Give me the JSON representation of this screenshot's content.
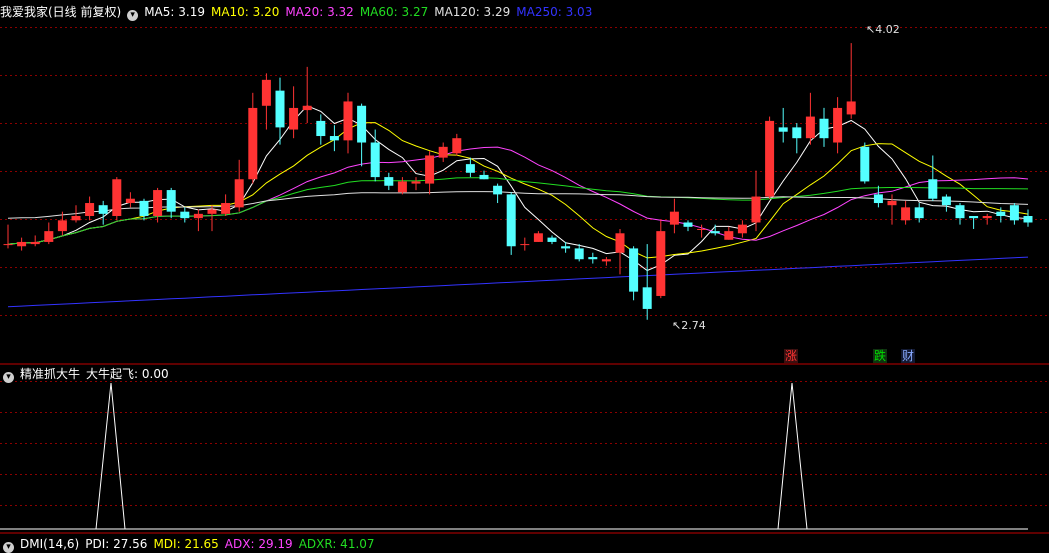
{
  "main_panel": {
    "title": "我爱我家(日线 前复权)",
    "indicators": [
      {
        "label": "MA5: 3.19",
        "color": "#ffffff"
      },
      {
        "label": "MA10: 3.20",
        "color": "#ffff00"
      },
      {
        "label": "MA20: 3.32",
        "color": "#ff44ff"
      },
      {
        "label": "MA60: 3.27",
        "color": "#22dd22"
      },
      {
        "label": "MA120: 3.29",
        "color": "#e0e0e0"
      },
      {
        "label": "MA250: 3.03",
        "color": "#3333ff"
      }
    ],
    "high_label": "4.02",
    "low_label": "2.74",
    "badges": [
      {
        "text": "涨",
        "color": "#ff3333"
      },
      {
        "text": "跌",
        "color": "#00dd00"
      },
      {
        "text": "财",
        "color": "#88aaff"
      }
    ]
  },
  "sub_panel": {
    "title": "精准抓大牛",
    "value_label": "大牛起飞: 0.00"
  },
  "dmi_panel": {
    "title": "DMI(14,6)",
    "values": [
      {
        "label": "PDI: 27.56",
        "color": "#ffffff"
      },
      {
        "label": "MDI: 21.65",
        "color": "#ffff00"
      },
      {
        "label": "ADX: 29.19",
        "color": "#ff44ff"
      },
      {
        "label": "ADXR: 41.07",
        "color": "#22dd22"
      }
    ]
  },
  "chart_data": {
    "type": "candlestick",
    "ylim": [
      2.6,
      4.15
    ],
    "candles": [
      [
        3.09,
        3.09,
        3.18,
        3.07
      ],
      [
        3.08,
        3.1,
        3.12,
        3.06
      ],
      [
        3.09,
        3.1,
        3.13,
        3.08
      ],
      [
        3.1,
        3.15,
        3.19,
        3.09
      ],
      [
        3.15,
        3.2,
        3.24,
        3.13
      ],
      [
        3.2,
        3.22,
        3.27,
        3.19
      ],
      [
        3.22,
        3.28,
        3.31,
        3.2
      ],
      [
        3.27,
        3.23,
        3.29,
        3.18
      ],
      [
        3.22,
        3.39,
        3.4,
        3.2
      ],
      [
        3.28,
        3.3,
        3.33,
        3.26
      ],
      [
        3.29,
        3.22,
        3.3,
        3.2
      ],
      [
        3.22,
        3.34,
        3.35,
        3.19
      ],
      [
        3.34,
        3.24,
        3.35,
        3.21
      ],
      [
        3.24,
        3.21,
        3.26,
        3.19
      ],
      [
        3.21,
        3.23,
        3.25,
        3.15
      ],
      [
        3.23,
        3.25,
        3.27,
        3.15
      ],
      [
        3.23,
        3.28,
        3.32,
        3.22
      ],
      [
        3.26,
        3.39,
        3.48,
        3.24
      ],
      [
        3.39,
        3.72,
        3.79,
        3.37
      ],
      [
        3.73,
        3.85,
        3.88,
        3.62
      ],
      [
        3.8,
        3.63,
        3.86,
        3.55
      ],
      [
        3.62,
        3.72,
        3.82,
        3.58
      ],
      [
        3.71,
        3.73,
        3.91,
        3.65
      ],
      [
        3.66,
        3.59,
        3.69,
        3.55
      ],
      [
        3.59,
        3.57,
        3.64,
        3.52
      ],
      [
        3.57,
        3.75,
        3.79,
        3.51
      ],
      [
        3.73,
        3.56,
        3.74,
        3.45
      ],
      [
        3.56,
        3.4,
        3.62,
        3.38
      ],
      [
        3.4,
        3.36,
        3.42,
        3.34
      ],
      [
        3.33,
        3.38,
        3.4,
        3.32
      ],
      [
        3.37,
        3.38,
        3.4,
        3.34
      ],
      [
        3.37,
        3.5,
        3.52,
        3.32
      ],
      [
        3.49,
        3.54,
        3.56,
        3.47
      ],
      [
        3.51,
        3.58,
        3.6,
        3.5
      ],
      [
        3.46,
        3.42,
        3.49,
        3.4
      ],
      [
        3.41,
        3.39,
        3.43,
        3.39
      ],
      [
        3.36,
        3.32,
        3.37,
        3.28
      ],
      [
        3.32,
        3.08,
        3.33,
        3.04
      ],
      [
        3.09,
        3.09,
        3.12,
        3.06
      ],
      [
        3.1,
        3.14,
        3.15,
        3.1
      ],
      [
        3.12,
        3.1,
        3.13,
        3.09
      ],
      [
        3.08,
        3.07,
        3.1,
        3.05
      ],
      [
        3.07,
        3.02,
        3.09,
        3.01
      ],
      [
        3.03,
        3.02,
        3.05,
        3.0
      ],
      [
        3.01,
        3.02,
        3.03,
        2.99
      ],
      [
        3.05,
        3.14,
        3.16,
        2.95
      ],
      [
        3.07,
        2.87,
        3.08,
        2.83
      ],
      [
        2.89,
        2.79,
        3.09,
        2.74
      ],
      [
        2.85,
        3.15,
        3.2,
        2.84
      ],
      [
        3.18,
        3.24,
        3.3,
        3.14
      ],
      [
        3.19,
        3.17,
        3.2,
        3.15
      ],
      [
        3.16,
        3.16,
        3.18,
        3.12
      ],
      [
        3.15,
        3.14,
        3.18,
        3.13
      ],
      [
        3.11,
        3.15,
        3.17,
        3.11
      ],
      [
        3.14,
        3.18,
        3.2,
        3.12
      ],
      [
        3.19,
        3.31,
        3.43,
        3.15
      ],
      [
        3.31,
        3.66,
        3.68,
        3.3
      ],
      [
        3.63,
        3.61,
        3.72,
        3.56
      ],
      [
        3.63,
        3.58,
        3.65,
        3.51
      ],
      [
        3.58,
        3.68,
        3.79,
        3.55
      ],
      [
        3.67,
        3.58,
        3.72,
        3.54
      ],
      [
        3.56,
        3.72,
        3.77,
        3.51
      ],
      [
        3.69,
        3.75,
        4.02,
        3.67
      ],
      [
        3.54,
        3.38,
        3.56,
        3.37
      ],
      [
        3.32,
        3.28,
        3.36,
        3.26
      ],
      [
        3.27,
        3.29,
        3.32,
        3.18
      ],
      [
        3.2,
        3.26,
        3.29,
        3.18
      ],
      [
        3.26,
        3.21,
        3.28,
        3.19
      ],
      [
        3.39,
        3.3,
        3.5,
        3.29
      ],
      [
        3.31,
        3.27,
        3.32,
        3.24
      ],
      [
        3.27,
        3.21,
        3.28,
        3.18
      ],
      [
        3.22,
        3.21,
        3.22,
        3.16
      ],
      [
        3.21,
        3.22,
        3.23,
        3.18
      ],
      [
        3.24,
        3.22,
        3.26,
        3.19
      ],
      [
        3.27,
        3.2,
        3.28,
        3.18
      ],
      [
        3.22,
        3.19,
        3.25,
        3.17
      ]
    ]
  }
}
